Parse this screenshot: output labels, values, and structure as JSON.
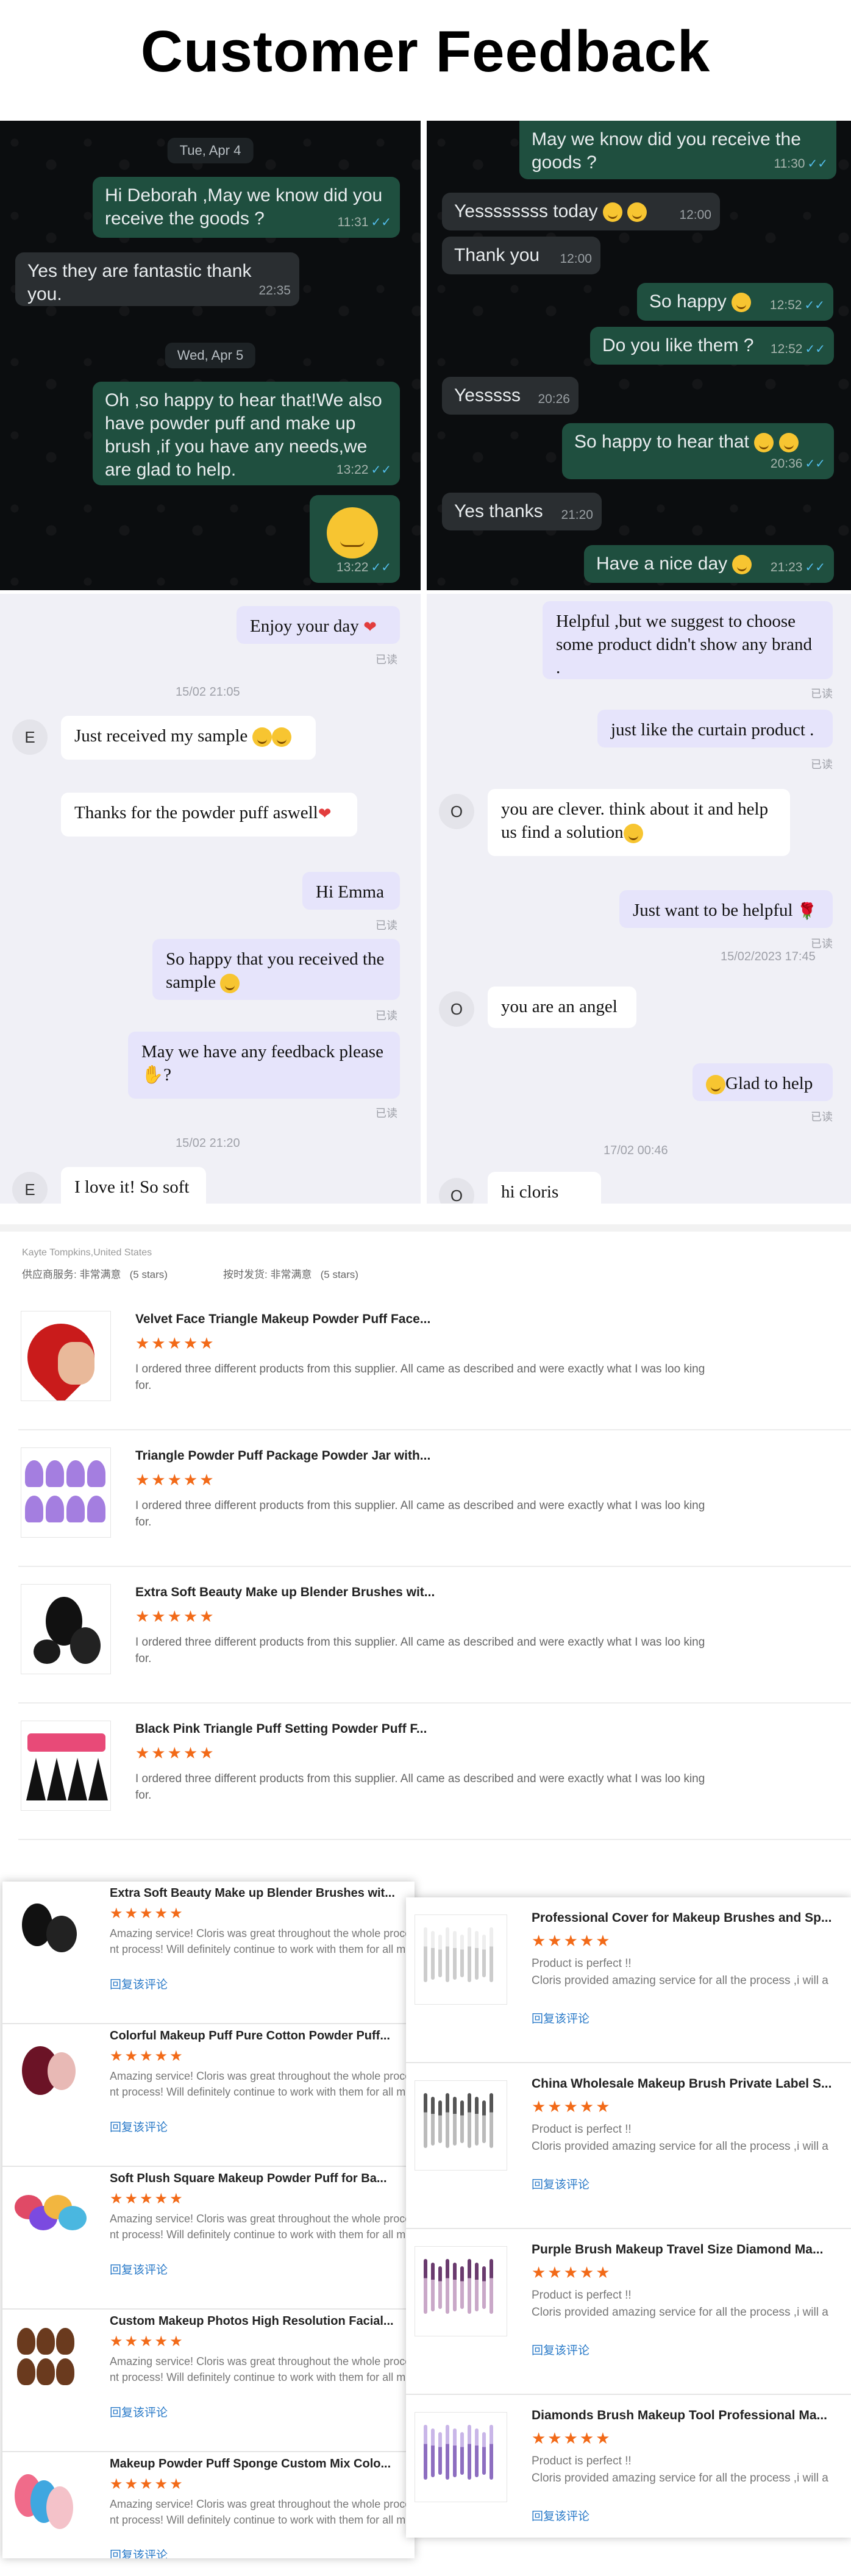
{
  "header": {
    "title": "Customer Feedback"
  },
  "chat1": {
    "date1": "Tue, Apr 4",
    "m1": "Hi Deborah ,May we know did you receive the goods ?",
    "m1_time": "11:31",
    "m2": "Yes they are fantastic thank you.",
    "m2_time": "22:35",
    "date2": "Wed, Apr 5",
    "m3": "Oh ,so happy to hear that!We also have powder puff and make up brush ,if you have any needs,we are glad to help.",
    "m3_time": "13:22",
    "m4_time": "13:22"
  },
  "chat2": {
    "m1": "May we know did you receive the goods ?",
    "m1_time": "11:30",
    "m2": "Yessssssss today",
    "m2_time": "12:00",
    "m3": "Thank you",
    "m3_time": "12:00",
    "m4": "So happy",
    "m4_time": "12:52",
    "m5": "Do you like them ?",
    "m5_time": "12:52",
    "m6": "Yesssss",
    "m6_time": "20:26",
    "m7": "So happy to hear that",
    "m7_time": "20:36",
    "m8": "Yes thanks",
    "m8_time": "21:20",
    "m9": "Have a nice day",
    "m9_time": "21:23"
  },
  "chat3": {
    "m1": "Enjoy your day",
    "read": "已读",
    "stamp1": "15/02 21:05",
    "avatar": "E",
    "m2": "Just received my sample",
    "m3": "Thanks for the powder puff aswell",
    "m4": "Hi Emma",
    "m5": "So happy that you received the sample",
    "m6": "May we have any feedback please",
    "m6b": "?",
    "stamp2": "15/02 21:20",
    "m7": "I love it! So soft"
  },
  "chat4": {
    "m1": "Helpful ,but we suggest to choose some product didn't show any brand .",
    "read": "已读",
    "m2": "just like the curtain product .",
    "avatar": "O",
    "m3": "you are clever. think about it and help us find a solution",
    "m4": "Just want to be helpful",
    "stamp1": "15/02/2023 17:45",
    "m5": "you are an angel",
    "m6": "Glad to help",
    "stamp2": "17/02 00:46",
    "m7": "hi cloris"
  },
  "review": {
    "buyer": "Kayte Tompkins,United States",
    "supplier_label": "供应商服务: 非常满意",
    "supplier_stars": "(5 stars)",
    "ship_label": "按时发货: 非常满意",
    "ship_stars": "(5 stars)",
    "stars": "★★★★★",
    "items": [
      {
        "title": "Velvet Face Triangle Makeup Powder Puff Face...",
        "text": "I ordered three different products from this supplier. All came as described and were exactly what I was loo king for."
      },
      {
        "title": "Triangle Powder Puff Package Powder Jar with...",
        "text": "I ordered three different products from this supplier. All came as described and were exactly what I was loo king for."
      },
      {
        "title": "Extra Soft Beauty Make up Blender Brushes wit...",
        "text": "I ordered three different products from this supplier. All came as described and were exactly what I was loo king for."
      },
      {
        "title": "Black Pink Triangle Puff Setting Powder Puff F...",
        "text": "I ordered three different products from this supplier. All came as described and were exactly what I was loo king for."
      }
    ]
  },
  "leftcards": {
    "stars": "★★★★★",
    "link": "回复该评论",
    "text1": "Amazing service! Cloris was great throughout the whole proce",
    "text2": "nt process! Will definitely continue to work with them for all m",
    "items": [
      {
        "title": "Extra Soft Beauty Make up Blender Brushes wit..."
      },
      {
        "title": "Colorful Makeup Puff Pure Cotton Powder Puff..."
      },
      {
        "title": "Soft Plush Square Makeup Powder Puff for Ba..."
      },
      {
        "title": "Custom Makeup Photos High Resolution Facial..."
      },
      {
        "title": "Makeup Powder Puff Sponge Custom Mix Colo..."
      }
    ]
  },
  "rightcards": {
    "stars": "★★★★★",
    "link": "回复该评论",
    "text1": "Product is perfect !!",
    "text2": "Cloris provided amazing service for all the process ,i will a",
    "items": [
      {
        "title": "Professional Cover for Makeup Brushes and Sp..."
      },
      {
        "title": "China Wholesale Makeup Brush Private Label S..."
      },
      {
        "title": "Purple Brush Makeup Travel Size Diamond Ma..."
      },
      {
        "title": "Diamonds Brush Makeup Tool Professional Ma..."
      }
    ]
  }
}
